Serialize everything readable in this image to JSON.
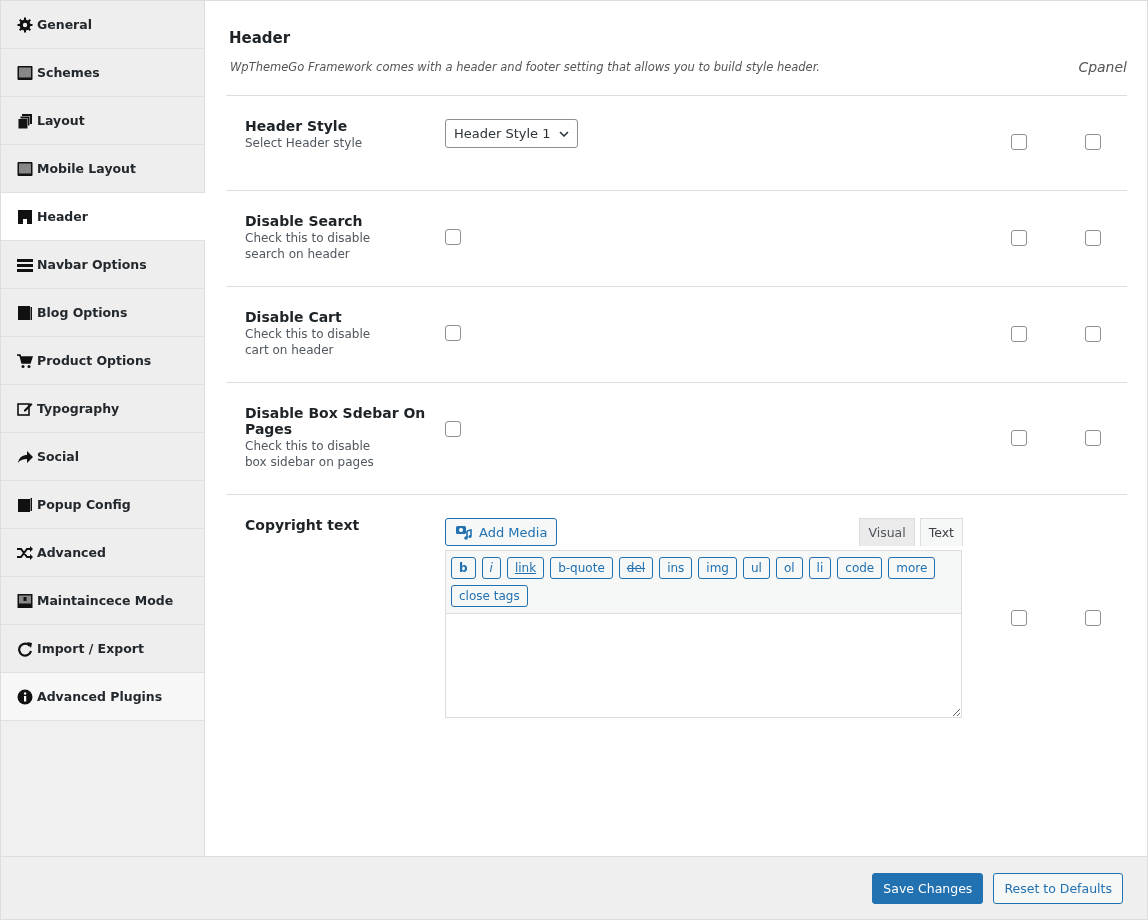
{
  "sidebar": {
    "items": [
      {
        "label": "General",
        "selected": false
      },
      {
        "label": "Schemes",
        "selected": false
      },
      {
        "label": "Layout",
        "selected": false
      },
      {
        "label": "Mobile Layout",
        "selected": false
      },
      {
        "label": "Header",
        "selected": true
      },
      {
        "label": "Navbar Options",
        "selected": false
      },
      {
        "label": "Blog Options",
        "selected": false
      },
      {
        "label": "Product Options",
        "selected": false
      },
      {
        "label": "Typography",
        "selected": false
      },
      {
        "label": "Social",
        "selected": false
      },
      {
        "label": "Popup Config",
        "selected": false
      },
      {
        "label": "Advanced",
        "selected": false
      },
      {
        "label": "Maintaincece Mode",
        "selected": false
      },
      {
        "label": "Import / Export",
        "selected": false
      },
      {
        "label": "Advanced Plugins",
        "selected": false
      }
    ]
  },
  "section": {
    "title": "Header",
    "description": "WpThemeGo Framework comes with a header and footer setting that allows you to build style header.",
    "side_label": "Cpanel"
  },
  "settings": [
    {
      "kind": "select",
      "title": "Header Style",
      "hint": "Select Header style",
      "value": "Header Style 1",
      "extra_checks": [
        false,
        false
      ]
    },
    {
      "kind": "checkbox",
      "title": "Disable Search",
      "hint": "Check this to disable search on header",
      "checked": false,
      "extra_checks": [
        false,
        false
      ]
    },
    {
      "kind": "checkbox",
      "title": "Disable Cart",
      "hint": "Check this to disable cart on header",
      "checked": false,
      "extra_checks": [
        false,
        false
      ]
    },
    {
      "kind": "checkbox",
      "title": "Disable Box Sdebar On Pages",
      "hint": "Check this to disable box sidebar on pages",
      "checked": false,
      "extra_checks": [
        false,
        false
      ]
    },
    {
      "kind": "editor",
      "title": "Copyright text",
      "media_button": "Add Media",
      "tabs": [
        {
          "label": "Visual",
          "selected": false
        },
        {
          "label": "Text",
          "selected": true
        }
      ],
      "toolbar": [
        {
          "label": "b",
          "kind": "bold"
        },
        {
          "label": "i",
          "kind": "italic"
        },
        {
          "label": "link",
          "kind": "link"
        },
        {
          "label": "b-quote",
          "kind": "plain"
        },
        {
          "label": "del",
          "kind": "strike"
        },
        {
          "label": "ins",
          "kind": "plain"
        },
        {
          "label": "img",
          "kind": "plain"
        },
        {
          "label": "ul",
          "kind": "plain"
        },
        {
          "label": "ol",
          "kind": "plain"
        },
        {
          "label": "li",
          "kind": "plain"
        },
        {
          "label": "code",
          "kind": "plain"
        },
        {
          "label": "more",
          "kind": "plain"
        },
        {
          "label": "close tags",
          "kind": "plain"
        }
      ],
      "extra_checks": [
        false,
        false
      ]
    }
  ],
  "footer": {
    "primary": "Save Changes",
    "secondary": "Reset to Defaults"
  }
}
